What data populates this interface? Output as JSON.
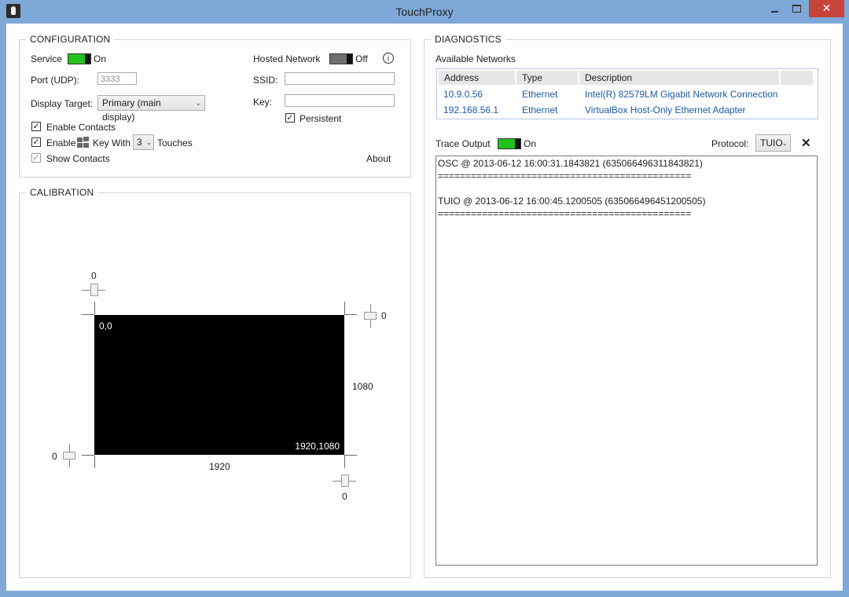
{
  "window": {
    "title": "TouchProxy",
    "close_glyph": "✕"
  },
  "configuration": {
    "title": "CONFIGURATION",
    "service_label": "Service",
    "service_state": "On",
    "port_label": "Port (UDP):",
    "port_value": "3333",
    "display_target_label": "Display Target:",
    "display_target_value": "Primary (main display)",
    "hosted_network_label": "Hosted Network",
    "hosted_network_state": "Off",
    "ssid_label": "SSID:",
    "ssid_value": "",
    "key_label": "Key:",
    "key_value": "",
    "persistent_label": "Persistent",
    "enable_contacts_label": "Enable Contacts",
    "enable_label": "Enable",
    "key_with_label": "Key With",
    "touches_count": "3",
    "touches_label": "Touches",
    "show_contacts_label": "Show Contacts",
    "about_label": "About",
    "info_glyph": "i"
  },
  "calibration": {
    "title": "CALIBRATION",
    "top_offset": "0",
    "right_offset": "0",
    "left_offset": "0",
    "bottom_offset": "0",
    "origin_label": "0,0",
    "extent_label": "1920,1080",
    "width_label": "1920",
    "height_label": "1080"
  },
  "diagnostics": {
    "title": "DIAGNOSTICS",
    "available_networks_label": "Available Networks",
    "columns": [
      "Address",
      "Type",
      "Description"
    ],
    "networks": [
      {
        "address": "10.9.0.56",
        "type": "Ethernet",
        "description": "Intel(R) 82579LM Gigabit Network Connection"
      },
      {
        "address": "192.168.56.1",
        "type": "Ethernet",
        "description": "VirtualBox Host-Only Ethernet Adapter"
      }
    ],
    "trace_output_label": "Trace Output",
    "trace_output_state": "On",
    "protocol_label": "Protocol:",
    "protocol_value": "TUIO",
    "clear_glyph": "✕",
    "trace_lines": [
      "OSC @ 2013-06-12 16:00:31.1843821 (635066496311843821)",
      "==============================================",
      "",
      "TUIO @ 2013-06-12 16:00:45.1200505 (635066496451200505)",
      "=============================================="
    ]
  },
  "colors": {
    "title_bar": "#7ea8d8",
    "toggle_on": "#21c21b",
    "close_button": "#c7443a",
    "link_text": "#1d5aa0"
  }
}
